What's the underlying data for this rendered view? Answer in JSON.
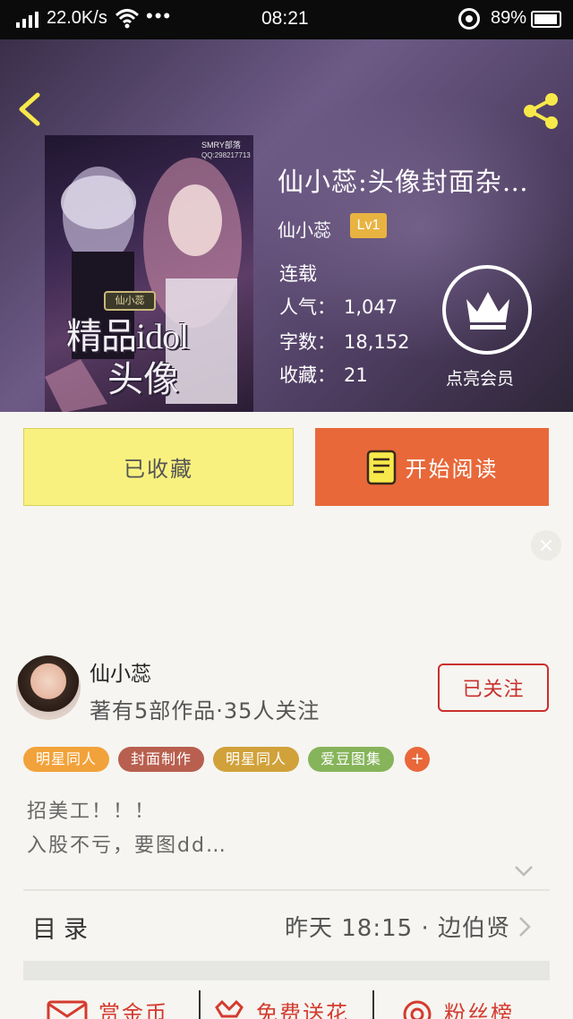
{
  "status_bar": {
    "network_speed": "22.0K/s",
    "more": "•••",
    "time": "08:21",
    "battery": "89%"
  },
  "book": {
    "title": "仙小蕊:头像封面杂…",
    "author": "仙小蕊",
    "level": "Lv1",
    "status": "连载",
    "popularity_label": "人气：",
    "popularity": "1,047",
    "words_label": "字数：",
    "words": "18,152",
    "favorites_label": "收藏：",
    "favorites": "21",
    "vip_label": "点亮会员",
    "cover": {
      "brand": "SMRY部落",
      "qq": "QQ:298217713",
      "seal": "仙小蕊",
      "title_line1": "精品idol",
      "title_line2": "头像"
    }
  },
  "actions": {
    "favorited_label": "已收藏",
    "read_label": "开始阅读"
  },
  "author_card": {
    "name": "仙小蕊",
    "stats": "著有5部作品·35人关注",
    "follow_label": "已关注"
  },
  "tags": [
    {
      "label": "明星同人",
      "color": "#f2a23a"
    },
    {
      "label": "封面制作",
      "color": "#b85f4f"
    },
    {
      "label": "明星同人",
      "color": "#d1a13a"
    },
    {
      "label": "爱豆图集",
      "color": "#86b45a"
    }
  ],
  "tag_more": "+",
  "description": {
    "line1": "招美工！！！",
    "line2": "入股不亏，要图dd…"
  },
  "toc": {
    "label": "目录",
    "latest": "昨天 18:15 · 边伯贤"
  },
  "bottom_actions": {
    "reward": "赏金币",
    "flowers": "免费送花",
    "fans": "粉丝榜"
  },
  "colors": {
    "accent_orange": "#e8683a",
    "favorite_yellow": "#f9f17f",
    "follow_red": "#c9302c",
    "level_gold": "#e9b341"
  }
}
